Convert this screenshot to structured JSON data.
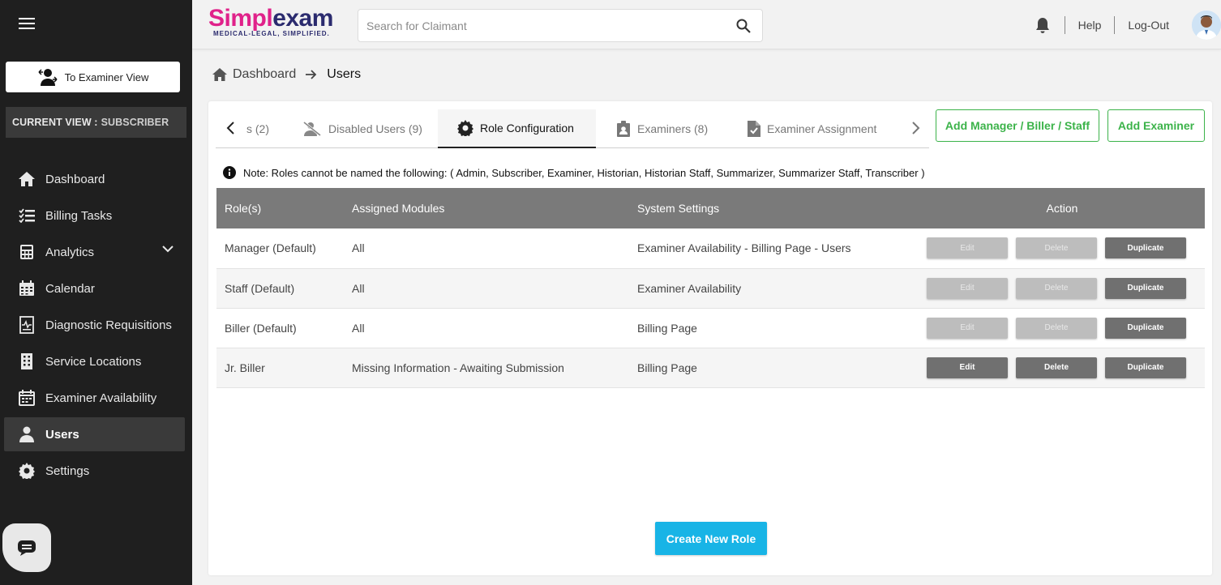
{
  "app": {
    "brand_a": "Simpl",
    "brand_b": "exam",
    "tagline": "MEDICAL-LEGAL, SIMPLIFIED."
  },
  "header": {
    "search_placeholder": "Search for Claimant",
    "help": "Help",
    "logout": "Log-Out"
  },
  "sidebar": {
    "examiner_view_label": "To Examiner View",
    "current_view_label": "CURRENT VIEW :",
    "current_view_value": "SUBSCRIBER",
    "items": [
      {
        "label": "Dashboard",
        "icon": "home-icon"
      },
      {
        "label": "Billing Tasks",
        "icon": "task-list-icon"
      },
      {
        "label": "Analytics",
        "icon": "calculator-icon"
      },
      {
        "label": "Calendar",
        "icon": "calendar-icon"
      },
      {
        "label": "Diagnostic Requisitions",
        "icon": "diagnostic-icon"
      },
      {
        "label": "Service Locations",
        "icon": "building-icon"
      },
      {
        "label": "Examiner Availability",
        "icon": "calendar-check-icon"
      },
      {
        "label": "Users",
        "icon": "user-icon"
      },
      {
        "label": "Settings",
        "icon": "gear-icon"
      }
    ]
  },
  "breadcrumb": {
    "home": "Dashboard",
    "current": "Users"
  },
  "tabs": [
    {
      "label": "s (2)"
    },
    {
      "label": "Disabled Users (9)"
    },
    {
      "label": "Role Configuration"
    },
    {
      "label": "Examiners (8)"
    },
    {
      "label": "Examiner Assignment"
    }
  ],
  "buttons": {
    "add_manager": "Add Manager / Biller / Staff",
    "add_examiner": "Add Examiner",
    "create_role": "Create New Role"
  },
  "note": "Note: Roles cannot be named the following: ( Admin, Subscriber, Examiner, Historian, Historian Staff, Summarizer, Summarizer Staff, Transcriber )",
  "table": {
    "headers": [
      "Role(s)",
      "Assigned Modules",
      "System Settings",
      "Action"
    ],
    "action_labels": {
      "edit": "Edit",
      "delete": "Delete",
      "duplicate": "Duplicate"
    },
    "rows": [
      {
        "role": "Manager (Default)",
        "modules": "All",
        "settings": "Examiner Availability - Billing Page - Users"
      },
      {
        "role": "Staff (Default)",
        "modules": "All",
        "settings": "Examiner Availability"
      },
      {
        "role": "Biller (Default)",
        "modules": "All",
        "settings": "Billing Page"
      },
      {
        "role": "Jr. Biller",
        "modules": "Missing Information - Awaiting Submission",
        "settings": "Billing Page"
      }
    ]
  },
  "colors": {
    "accent_green": "#3cb34a",
    "accent_blue": "#18b4e6",
    "sidebar_bg": "#1f1f1f",
    "brand_pink": "#e0228a",
    "brand_navy": "#2b2b6e"
  }
}
